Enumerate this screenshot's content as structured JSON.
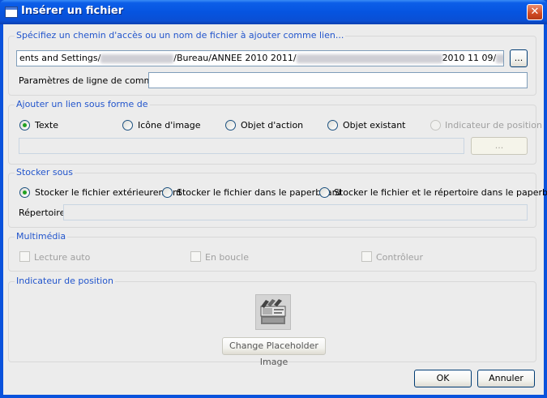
{
  "window": {
    "title": "Insérer un fichier",
    "close_glyph": "✕"
  },
  "link_group": {
    "title": "Spécifiez un chemin d'accès ou un nom de fichier à ajouter comme lien...",
    "path_visible_parts": [
      "ents and Settings/",
      "/Bureau/ANNEE 2010 2011/",
      "2010 11 09/"
    ],
    "browse_label": "...",
    "cmd_label": "Paramètres de ligne de commande",
    "cmd_value": ""
  },
  "add_link_group": {
    "title": "Ajouter un lien sous forme de",
    "options": [
      {
        "label": "Texte",
        "checked": true,
        "enabled": true
      },
      {
        "label": "Icône d'image",
        "checked": false,
        "enabled": true
      },
      {
        "label": "Objet d'action",
        "checked": false,
        "enabled": true
      },
      {
        "label": "Objet existant",
        "checked": false,
        "enabled": true
      },
      {
        "label": "Indicateur de position",
        "checked": false,
        "enabled": false
      }
    ],
    "field_value": "",
    "browse_label": "..."
  },
  "store_group": {
    "title": "Stocker sous",
    "options": [
      {
        "label": "Stocker le fichier extérieurement",
        "checked": true
      },
      {
        "label": "Stocker le fichier dans le paperboard",
        "checked": false
      },
      {
        "label": "Stocker le fichier et le répertoire dans le paperboard",
        "checked": false
      }
    ],
    "dir_label": "Répertoire",
    "dir_value": ""
  },
  "multimedia_group": {
    "title": "Multimédia",
    "options": [
      {
        "label": "Lecture auto",
        "checked": false
      },
      {
        "label": "En boucle",
        "checked": false
      },
      {
        "label": "Contrôleur",
        "checked": false
      }
    ]
  },
  "placeholder_group": {
    "title": "Indicateur de position",
    "change_button": "Change Placeholder Image"
  },
  "footer": {
    "ok": "OK",
    "cancel": "Annuler"
  },
  "colors": {
    "title_bar": "#0654e0",
    "group_title": "#2255cc",
    "radio_selected": "#21a121",
    "dialog_bg": "#ececec"
  }
}
